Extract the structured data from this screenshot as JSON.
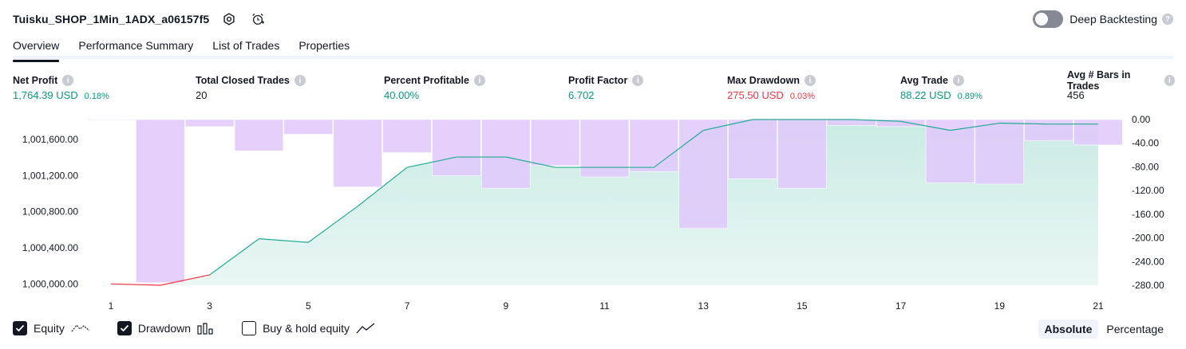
{
  "header": {
    "title": "Tuisku_SHOP_1Min_1ADX_a06157f5",
    "deep_backtesting_label": "Deep Backtesting",
    "deep_backtesting_on": false
  },
  "tabs": [
    {
      "label": "Overview",
      "active": true
    },
    {
      "label": "Performance Summary",
      "active": false
    },
    {
      "label": "List of Trades",
      "active": false
    },
    {
      "label": "Properties",
      "active": false
    }
  ],
  "metrics": [
    {
      "label": "Net Profit",
      "value": "1,764.39 USD",
      "sub": "0.18%",
      "tone": "pos"
    },
    {
      "label": "Total Closed Trades",
      "value": "20",
      "sub": "",
      "tone": "neutral"
    },
    {
      "label": "Percent Profitable",
      "value": "40.00%",
      "sub": "",
      "tone": "pos"
    },
    {
      "label": "Profit Factor",
      "value": "6.702",
      "sub": "",
      "tone": "pos"
    },
    {
      "label": "Max Drawdown",
      "value": "275.50 USD",
      "sub": "0.03%",
      "tone": "neg"
    },
    {
      "label": "Avg Trade",
      "value": "88.22 USD",
      "sub": "0.89%",
      "tone": "pos"
    },
    {
      "label": "Avg # Bars in Trades",
      "value": "456",
      "sub": "",
      "tone": "neutral"
    }
  ],
  "legend": {
    "equity_label": "Equity",
    "drawdown_label": "Drawdown",
    "buyhold_label": "Buy & hold equity",
    "equity_checked": true,
    "drawdown_checked": true,
    "buyhold_checked": false
  },
  "modes": {
    "absolute_label": "Absolute",
    "percentage_label": "Percentage",
    "active": "absolute"
  },
  "colors": {
    "equity_line": "#22ab94",
    "equity_fill": "#c9ebe3",
    "drawdown_bar": "#e1c8fc",
    "negative_line": "#f23645",
    "positive": "#089981",
    "negative": "#f23645"
  },
  "chart_data": {
    "type": "line",
    "x": [
      1,
      2,
      3,
      4,
      5,
      6,
      7,
      8,
      9,
      10,
      11,
      12,
      13,
      14,
      15,
      16,
      17,
      18,
      19,
      20,
      21
    ],
    "x_ticks": [
      "1",
      "3",
      "5",
      "7",
      "9",
      "11",
      "13",
      "15",
      "17",
      "19",
      "21"
    ],
    "series": [
      {
        "name": "Equity",
        "axis": "left",
        "values": [
          1000000,
          999985,
          1000100,
          1000500,
          1000460,
          1000860,
          1001290,
          1001405,
          1001405,
          1001290,
          1001290,
          1001290,
          1001700,
          1001820,
          1001820,
          1001820,
          1001800,
          1001700,
          1001780,
          1001770,
          1001770
        ]
      },
      {
        "name": "Drawdown",
        "axis": "right",
        "type": "bar",
        "values": [
          -1,
          -275.5,
          -12,
          -53,
          -25,
          -114,
          -56,
          -95,
          -116,
          -78,
          -97,
          -88,
          -184,
          -100,
          -116,
          -10,
          -12,
          -107,
          -109,
          -36,
          -43
        ]
      }
    ],
    "y_left": {
      "ticks": [
        "1,000,000.00",
        "1,000,400.00",
        "1,000,800.00",
        "1,001,200.00",
        "1,001,600.00"
      ],
      "min": 999985,
      "max": 1001820
    },
    "y_right": {
      "ticks": [
        "0.00",
        "-40.00",
        "-80.00",
        "-120.00",
        "-160.00",
        "-200.00",
        "-240.00",
        "-280.00"
      ],
      "min": -280,
      "max": 0
    },
    "grid": false
  }
}
